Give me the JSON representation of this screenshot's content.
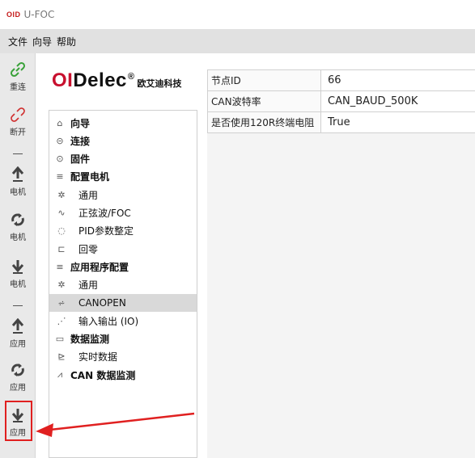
{
  "app": {
    "logo": "OID",
    "title": "U-FOC"
  },
  "menu": [
    "文件",
    "向导",
    "帮助"
  ],
  "toolbar": {
    "reconnect": "重连",
    "disconnect": "断开",
    "upload_motor": "电机",
    "sync_motor": "电机",
    "download_motor": "电机",
    "upload_app": "应用",
    "sync_app": "应用",
    "download_app": "应用"
  },
  "brand": {
    "name_red": "OI",
    "name_rest": "Delec",
    "reg": "®",
    "cn": "欧艾迪科技"
  },
  "tree": [
    {
      "label": "向导",
      "bold": true,
      "icon": "home-icon"
    },
    {
      "label": "连接",
      "bold": true,
      "icon": "link-icon"
    },
    {
      "label": "固件",
      "bold": true,
      "icon": "chip-icon"
    },
    {
      "label": "配置电机",
      "bold": true,
      "icon": "sliders-icon"
    },
    {
      "label": "通用",
      "bold": false,
      "icon": "gear-icon"
    },
    {
      "label": "正弦波/FOC",
      "bold": false,
      "icon": "wave-icon"
    },
    {
      "label": "PID参数整定",
      "bold": false,
      "icon": "tune-icon"
    },
    {
      "label": "回零",
      "bold": false,
      "icon": "home-return-icon"
    },
    {
      "label": "应用程序配置",
      "bold": true,
      "icon": "sliders-icon"
    },
    {
      "label": "通用",
      "bold": false,
      "icon": "gear-icon"
    },
    {
      "label": "CANOPEN",
      "bold": false,
      "icon": "canopen-icon",
      "selected": true
    },
    {
      "label": "输入输出 (IO)",
      "bold": false,
      "icon": "io-icon"
    },
    {
      "label": "数据监测",
      "bold": true,
      "icon": "monitor-icon"
    },
    {
      "label": "实时数据",
      "bold": false,
      "icon": "chart-icon"
    },
    {
      "label": "CAN 数据监测",
      "bold": true,
      "icon": "network-icon"
    }
  ],
  "properties": [
    {
      "key": "节点ID",
      "value": "66"
    },
    {
      "key": "CAN波特率",
      "value": "CAN_BAUD_500K"
    },
    {
      "key": "是否使用120R终端电阻",
      "value": "True"
    }
  ],
  "colors": {
    "accent_green": "#3aa23a",
    "accent_red": "#e02020",
    "brand_red": "#c8102e"
  }
}
